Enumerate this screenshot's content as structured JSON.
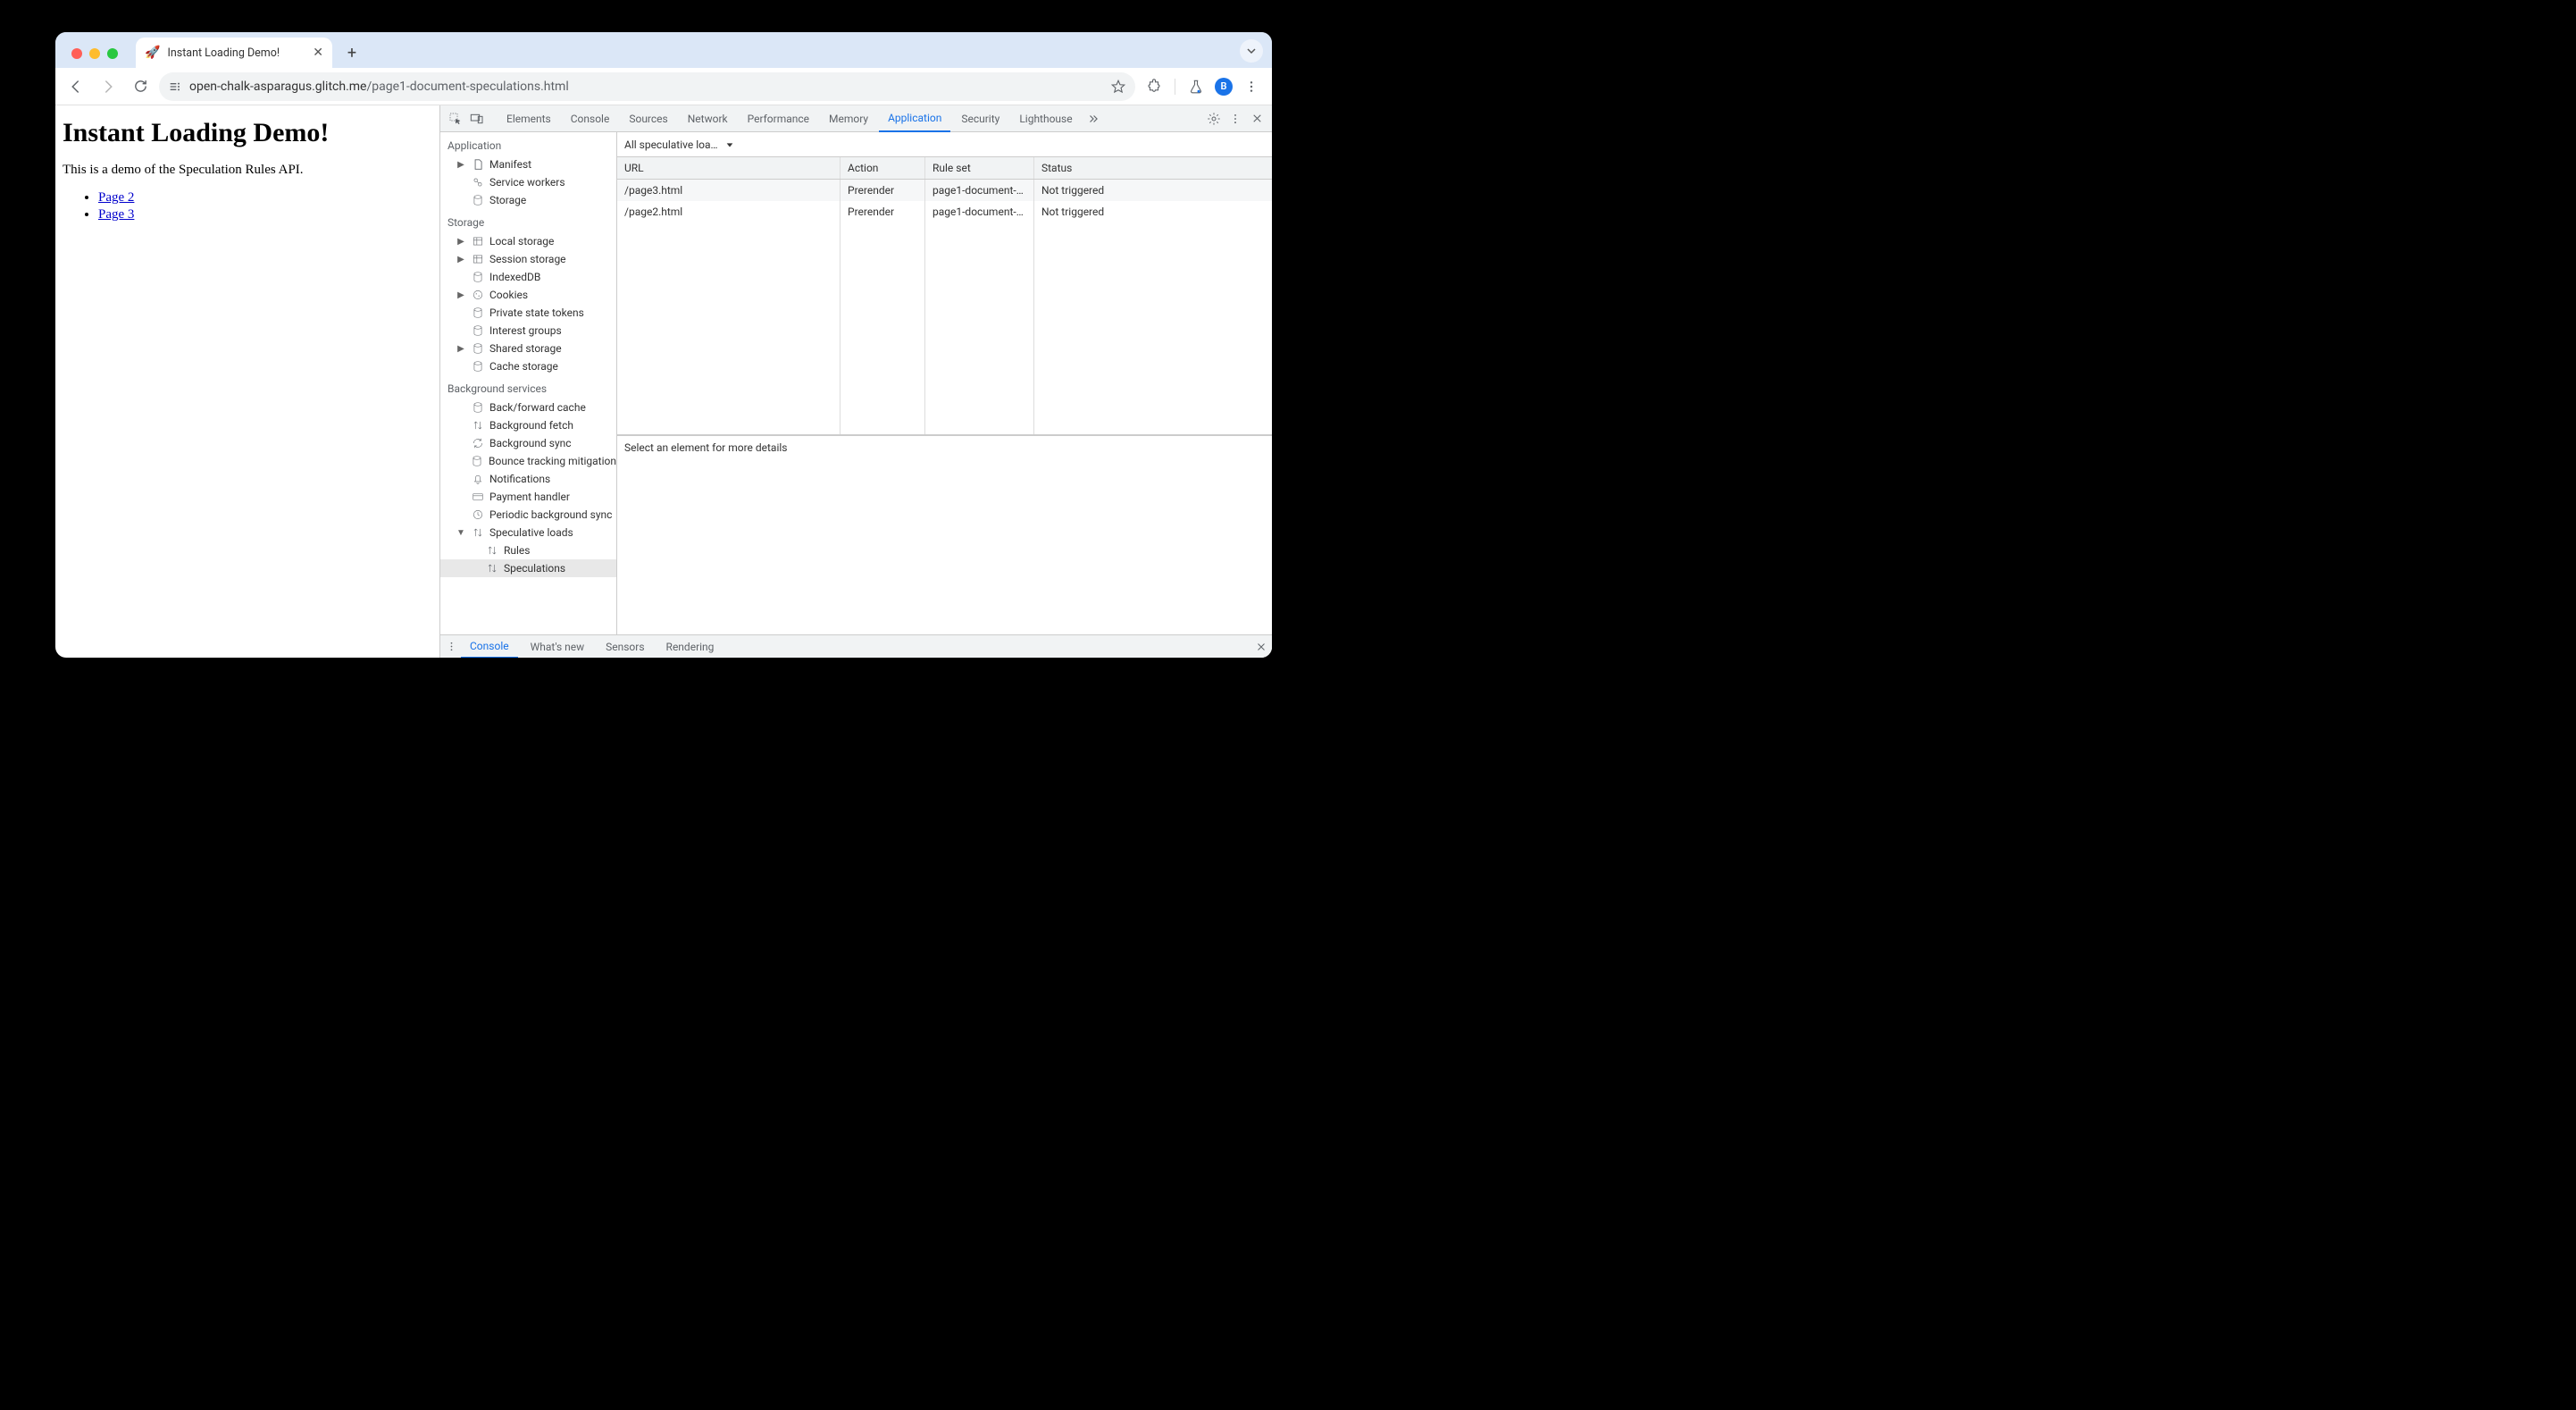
{
  "tab": {
    "title": "Instant Loading Demo!",
    "favicon": "🚀"
  },
  "omnibox": {
    "host": "open-chalk-asparagus.glitch.me",
    "path": "/page1-document-speculations.html"
  },
  "avatar_initial": "B",
  "page": {
    "heading": "Instant Loading Demo!",
    "intro": "This is a demo of the Speculation Rules API.",
    "links": [
      "Page 2",
      "Page 3"
    ]
  },
  "devtools": {
    "tabs": [
      "Elements",
      "Console",
      "Sources",
      "Network",
      "Performance",
      "Memory",
      "Application",
      "Security",
      "Lighthouse"
    ],
    "active_tab": "Application",
    "sidebar": {
      "sections": [
        {
          "title": "Application",
          "items": [
            {
              "label": "Manifest",
              "expandable": true
            },
            {
              "label": "Service workers"
            },
            {
              "label": "Storage"
            }
          ]
        },
        {
          "title": "Storage",
          "items": [
            {
              "label": "Local storage",
              "expandable": true
            },
            {
              "label": "Session storage",
              "expandable": true
            },
            {
              "label": "IndexedDB"
            },
            {
              "label": "Cookies",
              "expandable": true
            },
            {
              "label": "Private state tokens"
            },
            {
              "label": "Interest groups"
            },
            {
              "label": "Shared storage",
              "expandable": true
            },
            {
              "label": "Cache storage"
            }
          ]
        },
        {
          "title": "Background services",
          "items": [
            {
              "label": "Back/forward cache"
            },
            {
              "label": "Background fetch"
            },
            {
              "label": "Background sync"
            },
            {
              "label": "Bounce tracking mitigation"
            },
            {
              "label": "Notifications"
            },
            {
              "label": "Payment handler"
            },
            {
              "label": "Periodic background sync"
            },
            {
              "label": "Speculative loads",
              "expandable": true,
              "expanded": true,
              "children": [
                {
                  "label": "Rules"
                },
                {
                  "label": "Speculations",
                  "selected": true
                }
              ]
            }
          ]
        }
      ]
    },
    "main": {
      "filter": "All speculative loa…",
      "columns": [
        "URL",
        "Action",
        "Rule set",
        "Status"
      ],
      "rows": [
        {
          "url": "/page3.html",
          "action": "Prerender",
          "ruleset": "page1-document-…",
          "status": "Not triggered"
        },
        {
          "url": "/page2.html",
          "action": "Prerender",
          "ruleset": "page1-document-…",
          "status": "Not triggered"
        }
      ],
      "detail": "Select an element for more details"
    },
    "drawer_tabs": [
      "Console",
      "What's new",
      "Sensors",
      "Rendering"
    ],
    "drawer_active": "Console"
  }
}
